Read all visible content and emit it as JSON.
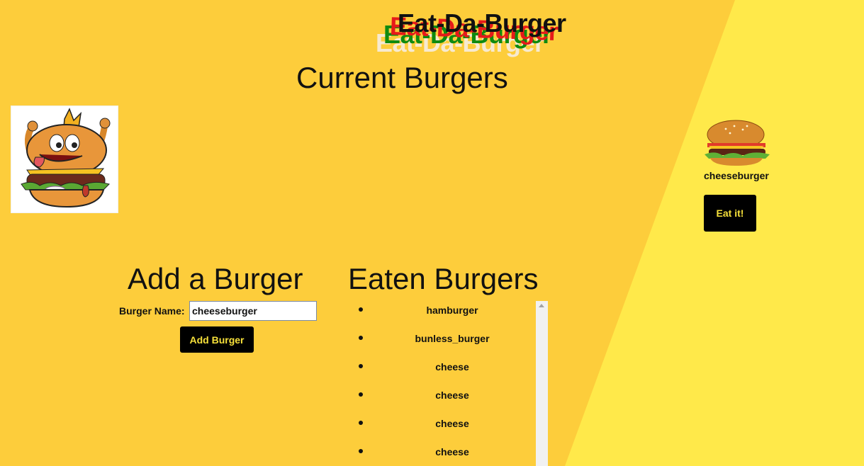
{
  "colors": {
    "background_orange": "#fdcd3b",
    "background_yellow": "#ffe94a",
    "button_bg": "#000000",
    "button_text": "#f6e03a"
  },
  "header": {
    "title": "Eat-Da-Burger"
  },
  "current": {
    "heading": "Current Burgers",
    "mascot_icon": "cartoon-burger-mascot",
    "burgers": [
      {
        "name": "cheeseburger",
        "icon": "burger-icon",
        "button_label": "Eat it!"
      }
    ]
  },
  "add": {
    "heading": "Add a Burger",
    "label": "Burger Name:",
    "input_value": "cheeseburger",
    "button_label": "Add Burger"
  },
  "eaten": {
    "heading": "Eaten Burgers",
    "items": [
      "hamburger",
      "bunless_burger",
      "cheese",
      "cheese",
      "cheese",
      "cheese"
    ]
  }
}
